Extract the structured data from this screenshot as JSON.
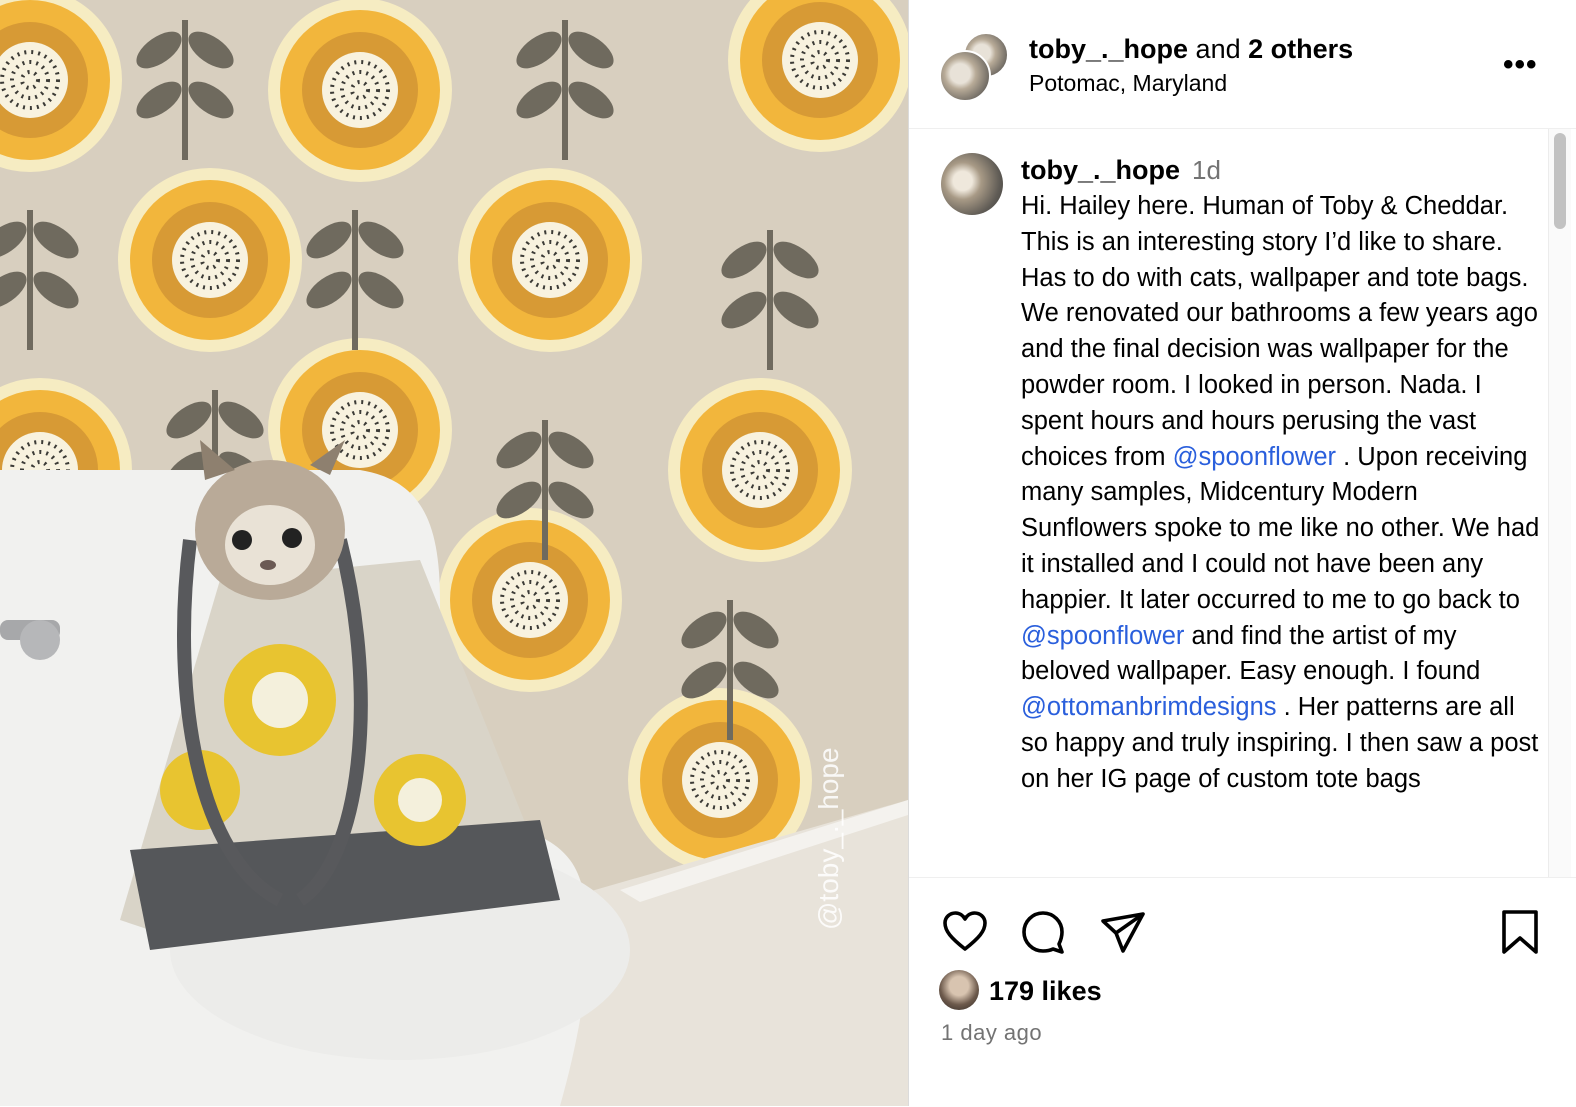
{
  "post": {
    "image": {
      "description": "cat peeking out of tote bag on toilet",
      "watermark": "@toby_._hope"
    },
    "header": {
      "username": "toby_._hope",
      "connector": "and",
      "others": "2 others",
      "location": "Potomac, Maryland",
      "more_icon": "more-horizontal-icon"
    },
    "caption": {
      "username": "toby_._hope",
      "time": "1d",
      "segments": [
        "Hi. Hailey here. Human of Toby & Cheddar. This is an interesting story I’d like to share. Has to do with cats, wallpaper and tote bags. We renovated our bathrooms a few years ago and the final decision was wallpaper for the powder room. I looked in person. Nada. I spent hours and hours perusing the vast choices from ",
        "@spoonflower",
        " . Upon receiving many samples, Midcentury Modern Sunflowers spoke to me like no other. We had it installed and I could not have been any happier. It later occurred to me to go back to ",
        "@spoonflower",
        " and find the artist of my beloved wallpaper. Easy enough. I found ",
        "@ottomanbrimdesigns",
        " . Her patterns are all so happy and truly inspiring. I then saw a post on her IG page of custom tote bags"
      ]
    },
    "actions": {
      "like_icon": "heart-icon",
      "comment_icon": "comment-icon",
      "share_icon": "share-icon",
      "save_icon": "bookmark-icon"
    },
    "likes": "179 likes",
    "time_ago": "1 day ago"
  },
  "colors": {
    "mention": "#2a5fdc",
    "muted": "#737373",
    "wallpaper_base": "#d8cfbf",
    "flower_outer": "#f3e6b6",
    "flower_mid": "#f2b63c",
    "flower_inner": "#c98a2a",
    "leaf": "#6f6a5e"
  }
}
